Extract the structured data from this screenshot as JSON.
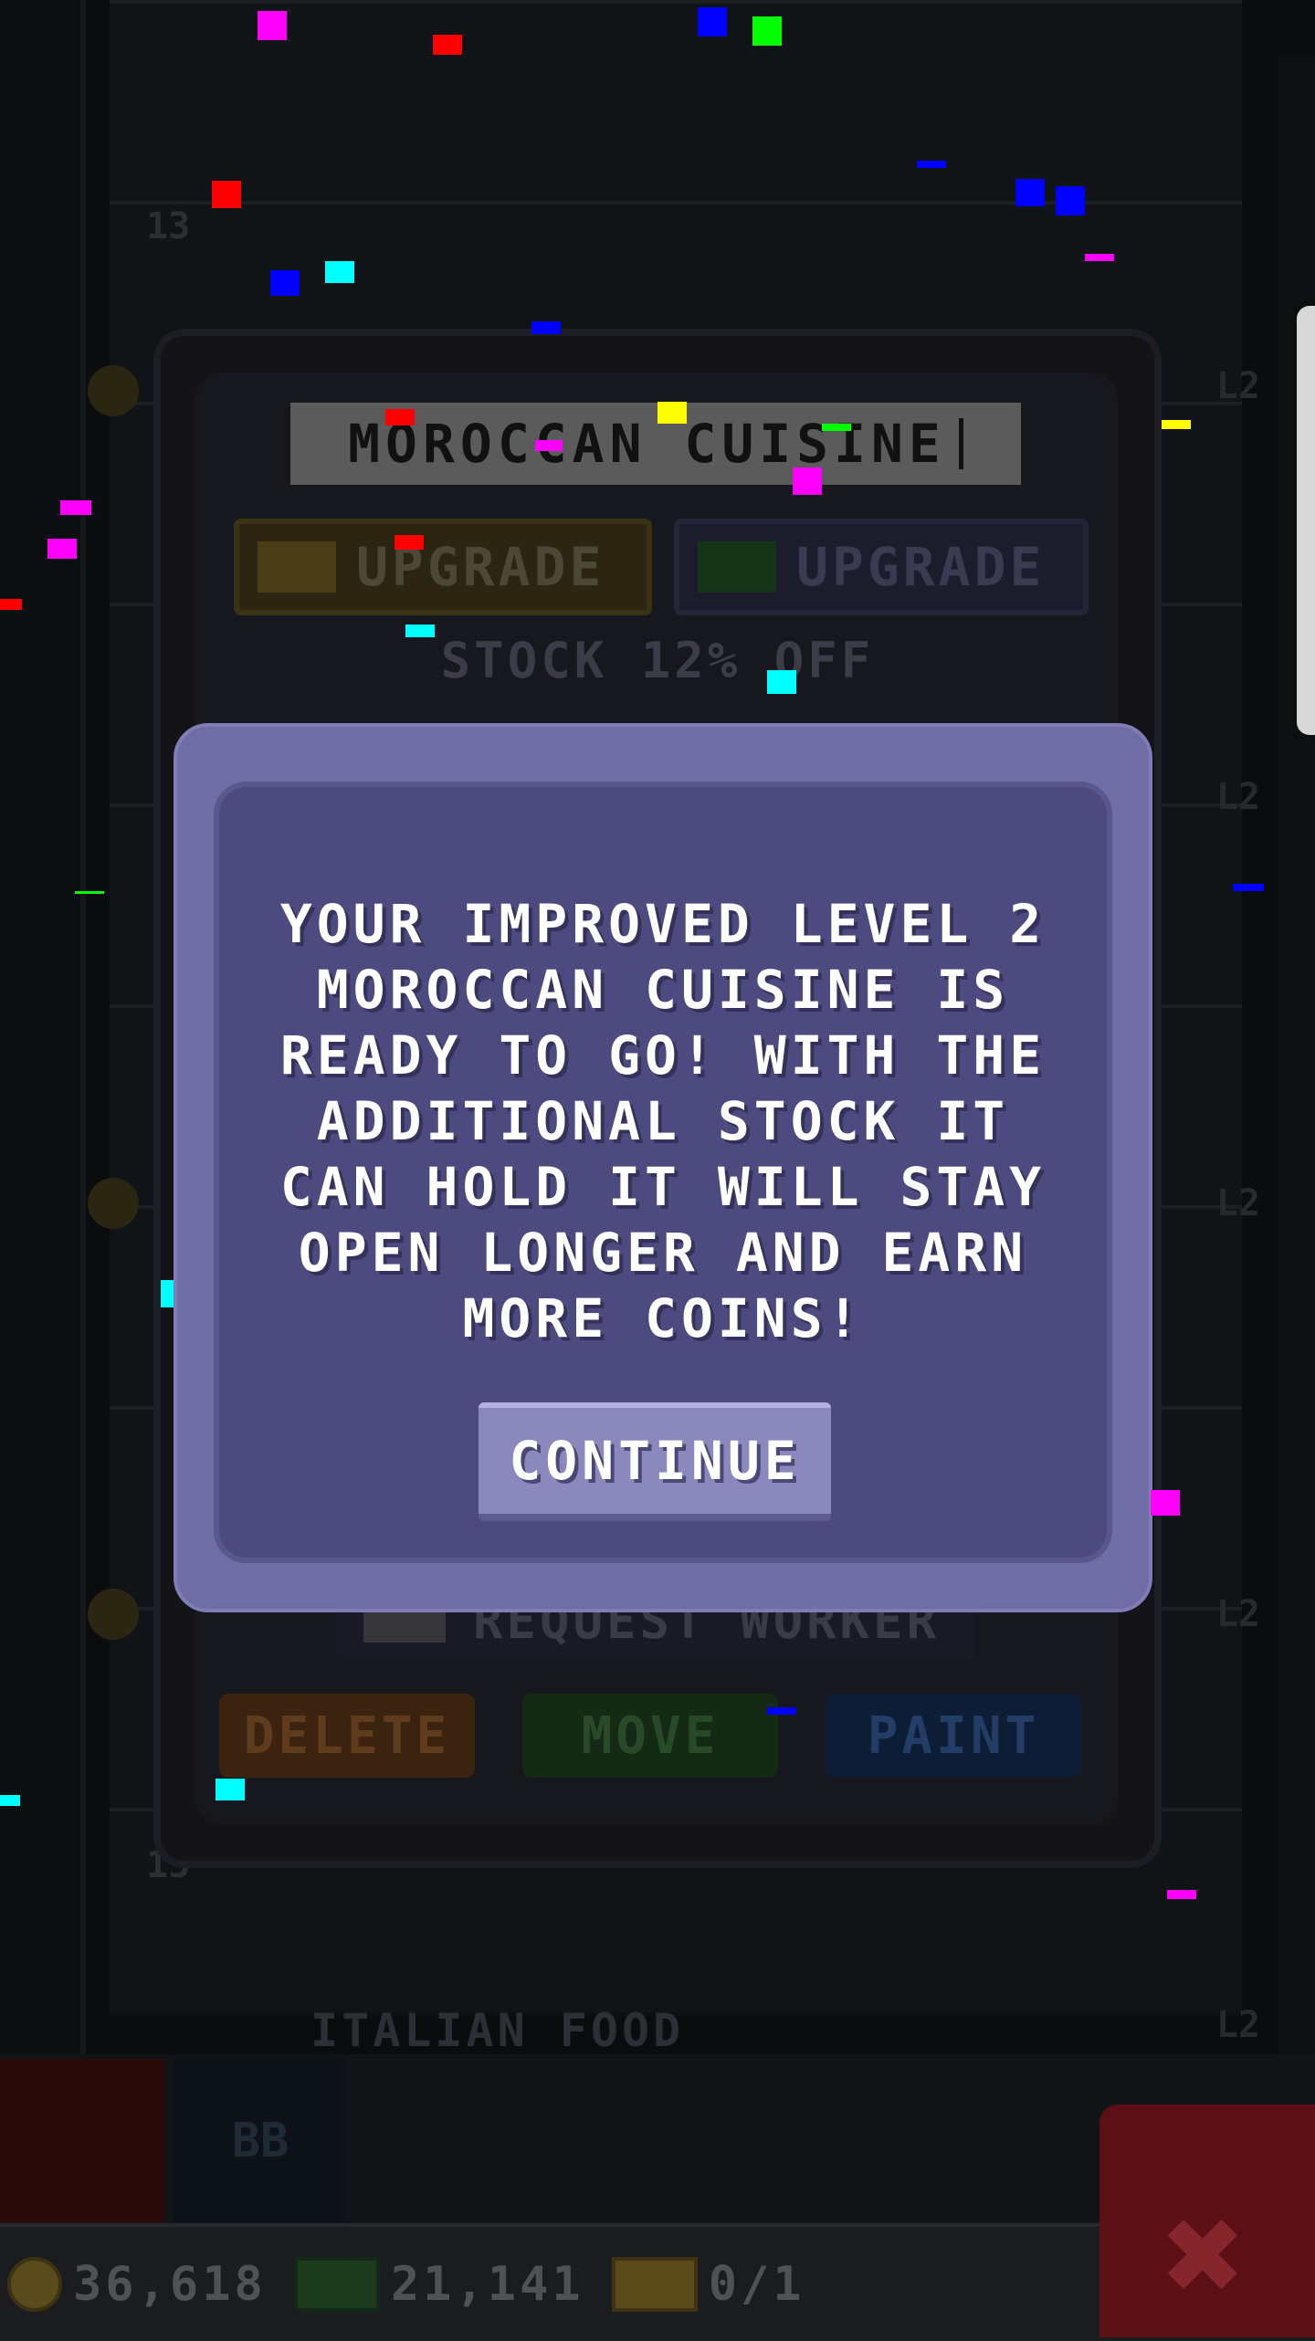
{
  "store": {
    "name": "MOROCCAN CUISINE",
    "upgrade_coins_label": "UPGRADE",
    "upgrade_cash_label": "UPGRADE",
    "stock_note": "STOCK 12% OFF",
    "request_worker_label": "REQUEST WORKER",
    "delete_label": "DELETE",
    "move_label": "MOVE",
    "paint_label": "PAINT"
  },
  "dialog": {
    "message": "YOUR IMPROVED LEVEL 2 MOROCCAN CUISINE IS READY TO GO! WITH THE ADDITIONAL STOCK IT CAN HOLD IT WILL STAY OPEN LONGER AND EARN MORE COINS!",
    "continue_label": "CONTINUE"
  },
  "background": {
    "floor_numbers": [
      "13",
      "15"
    ],
    "level_badges": [
      "L2",
      "L2",
      "L2",
      "L2",
      "L2"
    ],
    "italian_floor_label": "ITALIAN FOOD",
    "bottom_bb": "BB"
  },
  "status_bar": {
    "coins": "36,618",
    "cash": "21,141",
    "tickets": "0/1"
  },
  "colors": {
    "dialog_outer": "#706da6",
    "dialog_inner": "#4d4a80",
    "continue_button": "#8b88bd",
    "close_button": "#5c1016"
  },
  "icons": {
    "coin": "coin-icon",
    "cash": "cash-icon",
    "ticket": "ticket-icon",
    "close": "close-icon"
  }
}
